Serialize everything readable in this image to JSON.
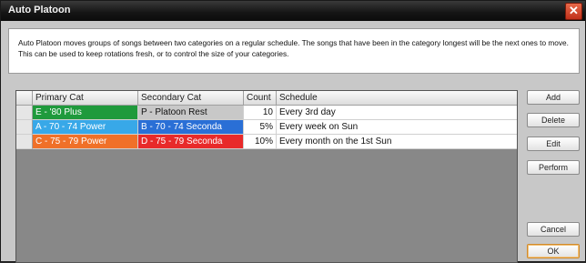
{
  "window": {
    "title": "Auto Platoon",
    "close_glyph": "✕"
  },
  "description": "Auto Platoon moves groups of songs between two categories on a regular schedule. The songs that have been in the category longest will be the next ones to move. This can be used to keep rotations fresh, or to control the size of your categories.",
  "table": {
    "headers": {
      "primary": "Primary Cat",
      "secondary": "Secondary Cat",
      "count": "Count",
      "schedule": "Schedule"
    },
    "rows": [
      {
        "primary": "E - '80 Plus",
        "primary_color": "#1f9a3c",
        "secondary": "P - Platoon Rest",
        "secondary_color": "#c8c8c8",
        "count": "10",
        "schedule": "Every 3rd day"
      },
      {
        "primary": "A - 70 - 74 Power",
        "primary_color": "#38a8e8",
        "secondary": "B - 70 - 74 Seconda",
        "secondary_color": "#2a6fd6",
        "count": "5%",
        "schedule": "Every week on Sun"
      },
      {
        "primary": "C - 75 - 79 Power",
        "primary_color": "#f07028",
        "secondary": "D - 75 - 79 Seconda",
        "secondary_color": "#e82a2a",
        "count": "10%",
        "schedule": "Every month on the 1st Sun"
      }
    ]
  },
  "buttons": {
    "add": "Add",
    "delete": "Delete",
    "edit": "Edit",
    "perform": "Perform",
    "cancel": "Cancel",
    "ok": "OK"
  }
}
